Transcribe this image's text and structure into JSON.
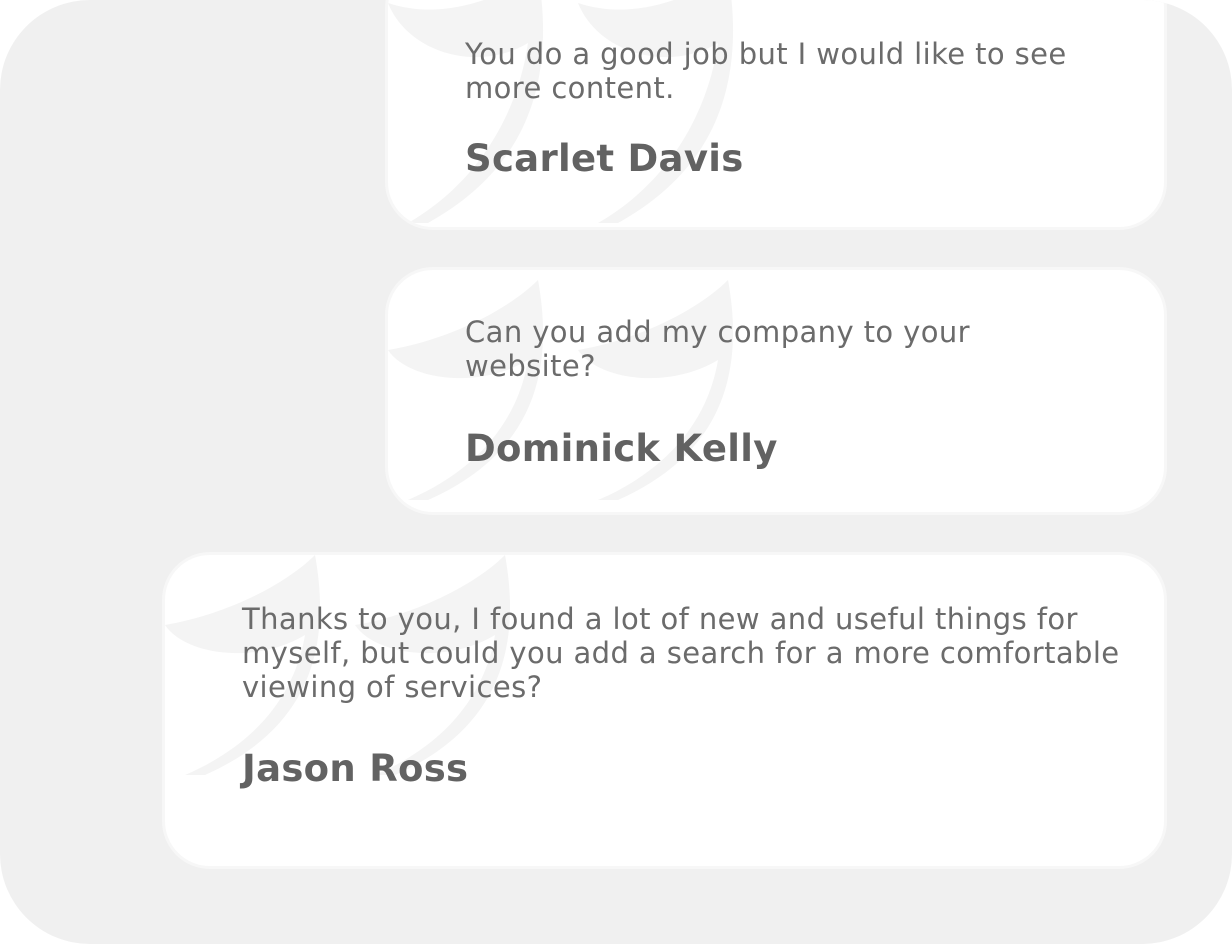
{
  "testimonials": [
    {
      "text": "You do a good job but I would like to see more content.",
      "name": "Scarlet Davis"
    },
    {
      "text": "Can you add my company to your website?",
      "name": "Dominick Kelly"
    },
    {
      "text": "Thanks to you, I found a lot of new and useful things for myself, but could you add a search for a more comfortable viewing of services?",
      "name": "Jason Ross"
    }
  ],
  "icons": {
    "quote": "quote-icon"
  },
  "colors": {
    "panel_background": "#f0f0f0",
    "card_background": "#ffffff",
    "text": "#6b6b6b",
    "name": "#626262",
    "quote_mark": "#f4f4f4"
  }
}
